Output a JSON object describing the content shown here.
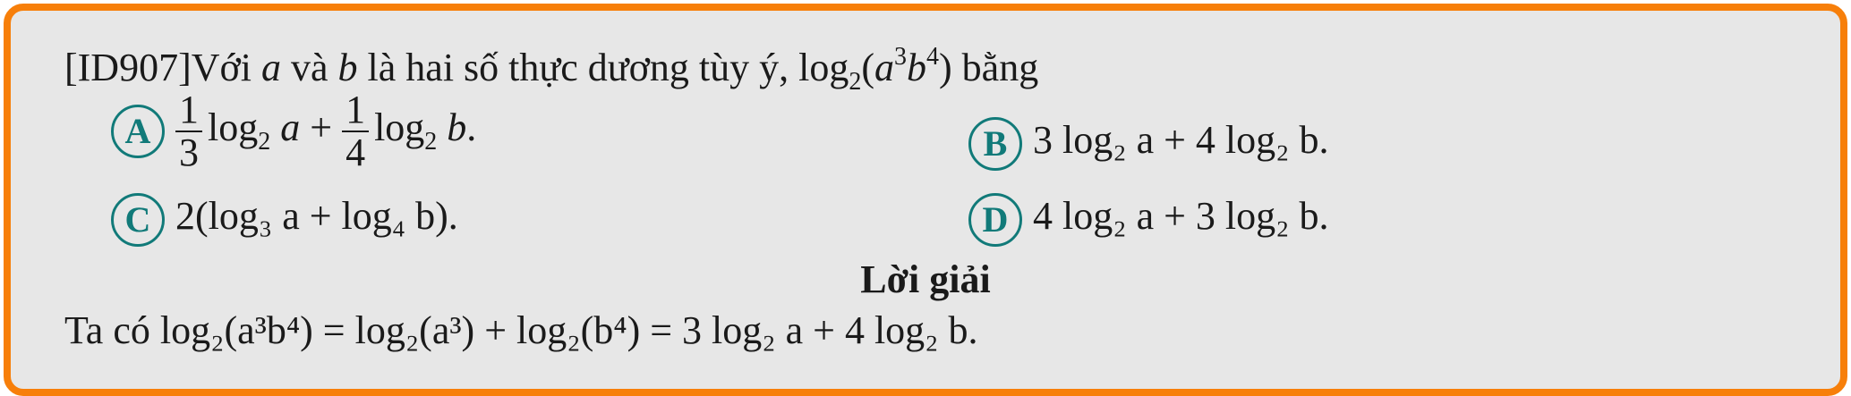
{
  "question": {
    "id": "[ID907]",
    "stem_prefix": "Với",
    "var_a": "a",
    "and": "và",
    "var_b": "b",
    "stem_mid": "là hai số thực dương tùy ý,",
    "expr_log": "log",
    "expr_base": "2",
    "expr_open": "(",
    "expr_exp3": "3",
    "expr_exp4": "4",
    "expr_close": ")",
    "stem_suffix": "bằng"
  },
  "options": {
    "A": {
      "letter": "A",
      "frac1_num": "1",
      "frac1_den": "3",
      "frac2_num": "1",
      "frac2_den": "4"
    },
    "B": {
      "letter": "B",
      "text": "3 log₂ a + 4 log₂ b."
    },
    "C": {
      "letter": "C",
      "text": "2(log₃ a + log₄ b)."
    },
    "D": {
      "letter": "D",
      "text": "4 log₂ a + 3 log₂ b."
    }
  },
  "solution": {
    "title": "Lời giải",
    "lead": "Ta có",
    "text": "log₂(a³b⁴) = log₂(a³) + log₂(b⁴) = 3 log₂ a + 4 log₂ b."
  },
  "colors": {
    "border": "#f77f0a",
    "background": "#e7e7e7",
    "option_circle": "#117a79"
  }
}
